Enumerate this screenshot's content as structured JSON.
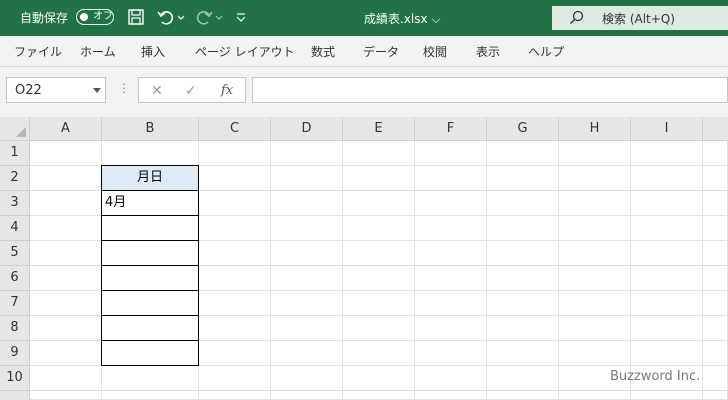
{
  "titlebar": {
    "autosave_label": "自動保存",
    "toggle_state": "オフ",
    "filename": "成績表.xlsx",
    "filename_chevron": "⌵",
    "search_placeholder": "検索 (Alt+Q)",
    "bg_color": "#217346"
  },
  "menu": {
    "items": [
      "ファイル",
      "ホーム",
      "挿入",
      "ページ レイアウト",
      "数式",
      "データ",
      "校閲",
      "表示",
      "ヘルプ"
    ]
  },
  "formula_bar": {
    "name_box": "O22",
    "fx_label": "fx",
    "formula_value": ""
  },
  "sheet": {
    "columns": [
      "A",
      "B",
      "C",
      "D",
      "E",
      "F",
      "G",
      "H",
      "I"
    ],
    "rows": [
      "1",
      "2",
      "3",
      "4",
      "5",
      "6",
      "7",
      "8",
      "9",
      "10"
    ],
    "table": {
      "header": "月日",
      "values": [
        "4月",
        "",
        "",
        "",
        "",
        "",
        ""
      ]
    },
    "header_fill": "#ddebf7"
  },
  "watermark": "Buzzword Inc."
}
